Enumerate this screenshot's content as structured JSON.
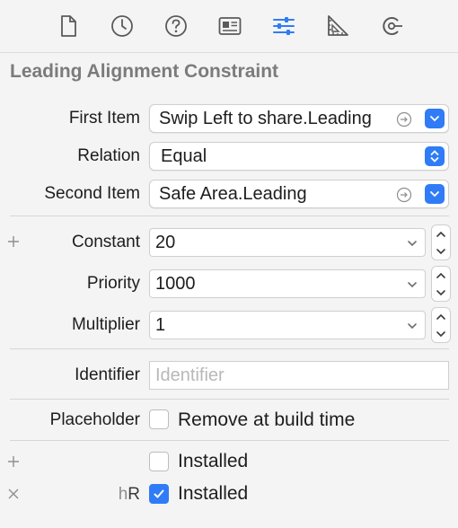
{
  "colors": {
    "accent": "#2f7cf6",
    "toolbar_icon": "#5a5a5a",
    "active_icon": "#2f7cf6"
  },
  "toolbar": {
    "icons": [
      {
        "name": "file-inspector-icon",
        "active": false
      },
      {
        "name": "history-inspector-icon",
        "active": false
      },
      {
        "name": "quick-help-icon",
        "active": false
      },
      {
        "name": "identity-inspector-icon",
        "active": false
      },
      {
        "name": "attributes-inspector-icon",
        "active": true
      },
      {
        "name": "size-inspector-icon",
        "active": false
      },
      {
        "name": "connections-inspector-icon",
        "active": false
      }
    ]
  },
  "section": {
    "title": "Leading Alignment Constraint"
  },
  "fields": {
    "first_item": {
      "label": "First Item",
      "value": "Swip Left to share.Leading"
    },
    "relation": {
      "label": "Relation",
      "value": "Equal"
    },
    "second_item": {
      "label": "Second Item",
      "value": "Safe Area.Leading"
    },
    "constant": {
      "label": "Constant",
      "value": "20"
    },
    "priority": {
      "label": "Priority",
      "value": "1000"
    },
    "multiplier": {
      "label": "Multiplier",
      "value": "1"
    },
    "identifier": {
      "label": "Identifier",
      "placeholder": "Identifier"
    },
    "placeholder": {
      "label": "Placeholder",
      "option": "Remove at build time",
      "checked": false
    }
  },
  "installed": [
    {
      "left_icon": "plus-icon",
      "size_class": "",
      "label": "Installed",
      "checked": false
    },
    {
      "left_icon": "close-icon",
      "size_class": "hR",
      "label": "Installed",
      "checked": true
    }
  ]
}
